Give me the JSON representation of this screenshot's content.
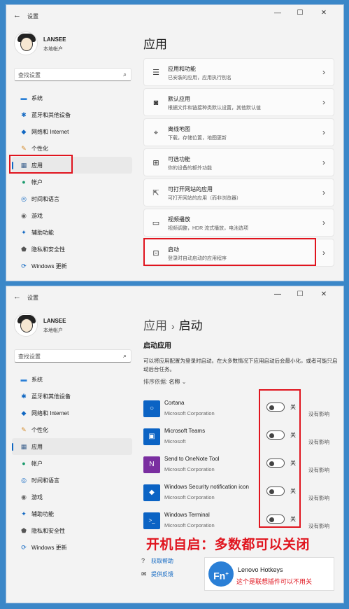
{
  "window_title": "设置",
  "controls": {
    "minimize": "—",
    "maximize": "☐",
    "close": "✕",
    "back": "←"
  },
  "user": {
    "name": "LANSEE",
    "type": "本地帐户"
  },
  "search_placeholder": "查找设置",
  "nav": [
    {
      "label": "系统",
      "icon": "monitor-icon"
    },
    {
      "label": "蓝牙和其他设备",
      "icon": "bluetooth-icon"
    },
    {
      "label": "网络和 Internet",
      "icon": "wifi-icon"
    },
    {
      "label": "个性化",
      "icon": "brush-icon"
    },
    {
      "label": "应用",
      "icon": "apps-icon",
      "active": true
    },
    {
      "label": "帐户",
      "icon": "person-icon"
    },
    {
      "label": "时间和语言",
      "icon": "globe-icon"
    },
    {
      "label": "游戏",
      "icon": "gamepad-icon"
    },
    {
      "label": "辅助功能",
      "icon": "accessibility-icon"
    },
    {
      "label": "隐私和安全性",
      "icon": "shield-icon"
    },
    {
      "label": "Windows 更新",
      "icon": "update-icon"
    }
  ],
  "apps_page": {
    "title": "应用",
    "cards": [
      {
        "title": "应用和功能",
        "subtitle": "已安装的应用，应用执行别名",
        "icon": "list-icon"
      },
      {
        "title": "默认应用",
        "subtitle": "根据文件和链接种类默认设置，其他默认值",
        "icon": "default-apps-icon"
      },
      {
        "title": "离线地图",
        "subtitle": "下载，存储位置，地图更新",
        "icon": "map-icon"
      },
      {
        "title": "可选功能",
        "subtitle": "你的设备的额外功能",
        "icon": "plus-grid-icon"
      },
      {
        "title": "可打开网站的应用",
        "subtitle": "可打开网站的应用（而非浏览器）",
        "icon": "open-link-icon"
      },
      {
        "title": "视频播放",
        "subtitle": "视频调整，HDR 流式播放，电池选项",
        "icon": "video-icon"
      },
      {
        "title": "启动",
        "subtitle": "登录时自动启动的应用程序",
        "icon": "startup-icon"
      }
    ]
  },
  "startup_page": {
    "breadcrumb_parent": "应用",
    "breadcrumb_sep": "›",
    "title": "启动",
    "section_heading": "启动应用",
    "description": "可以将应用配置为登录时启动。在大多数情况下应用启动后会最小化，或者可能只启动后台任务。",
    "sort_label": "排序依据:",
    "sort_value": "名称",
    "sort_chevron": "⌄",
    "apps": [
      {
        "name": "Cortana",
        "publisher": "Microsoft Corporation",
        "state": "关",
        "impact": "没有影响",
        "color": "#0b63c4",
        "glyph": "○"
      },
      {
        "name": "Microsoft Teams",
        "publisher": "Microsoft",
        "state": "关",
        "impact": "没有影响",
        "color": "#0b63c4",
        "glyph": "▣"
      },
      {
        "name": "Send to OneNote Tool",
        "publisher": "Microsoft Corporation",
        "state": "关",
        "impact": "没有影响",
        "color": "#7a2ea0",
        "glyph": "N"
      },
      {
        "name": "Windows Security notification icon",
        "publisher": "Microsoft Corporation",
        "state": "关",
        "impact": "没有影响",
        "color": "#0b63c4",
        "glyph": "◆"
      },
      {
        "name": "Windows Terminal",
        "publisher": "Microsoft Corporation",
        "state": "关",
        "impact": "没有影响",
        "color": "#0b63c4",
        "glyph": ">_"
      }
    ],
    "help_links": [
      {
        "label": "获取帮助",
        "icon": "help-icon"
      },
      {
        "label": "提供反馈",
        "icon": "feedback-icon"
      }
    ]
  },
  "annotation": "开机自启：多数都可以关闭",
  "lenovo": {
    "badge": "Fn",
    "badge_plus": "+",
    "title": "Lenovo Hotkeys",
    "note": "这个是联想插件可以不用关"
  },
  "colors": {
    "accent": "#1067c2",
    "highlight": "#e0141e",
    "background": "#3b87c8"
  }
}
